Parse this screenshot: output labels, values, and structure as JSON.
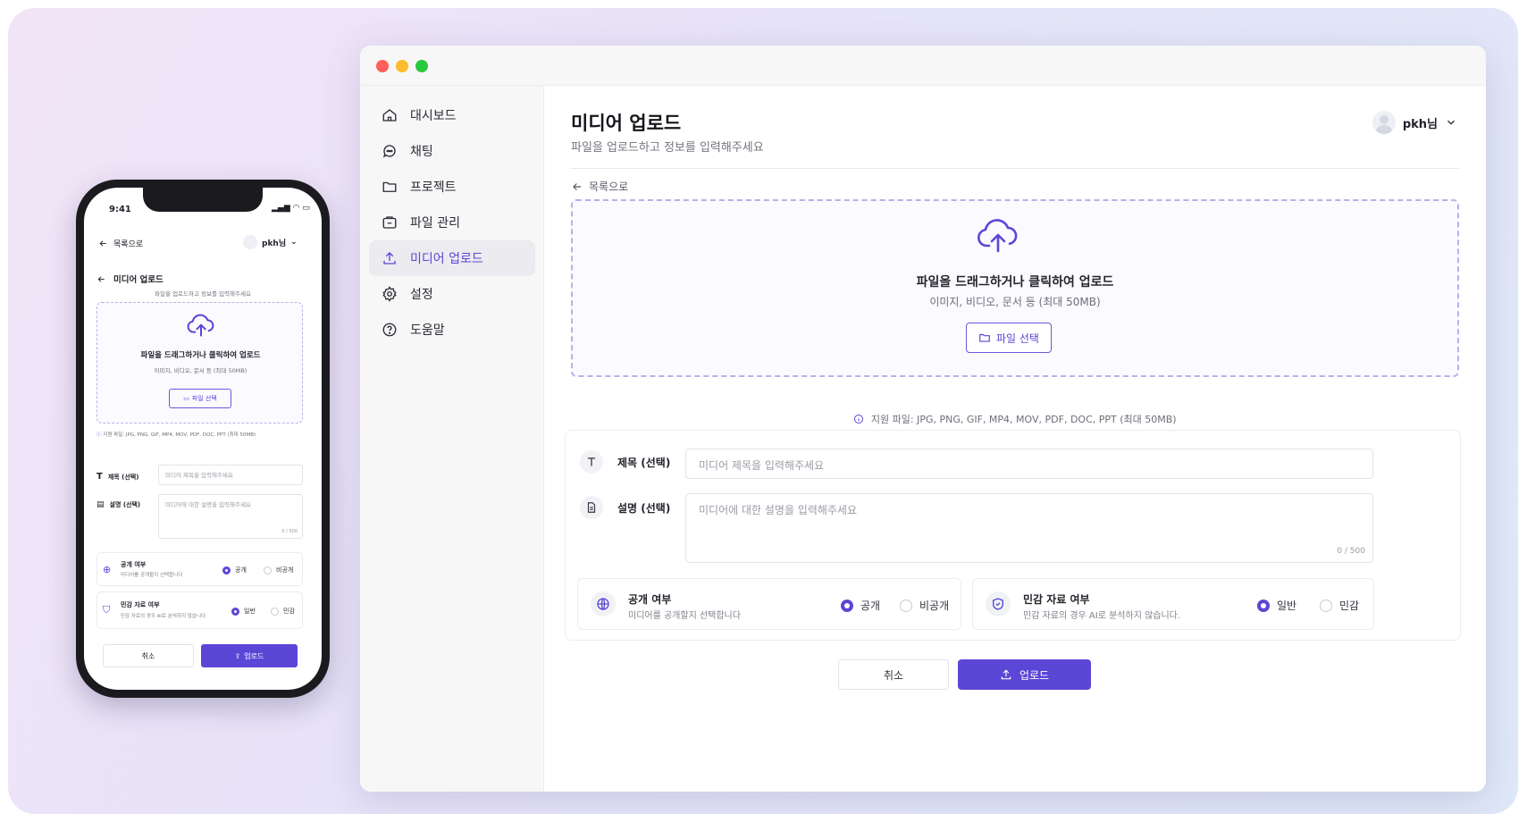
{
  "window": {
    "controls": [
      "close",
      "minimize",
      "maximize"
    ]
  },
  "sidebar": {
    "items": [
      {
        "label": "대시보드",
        "icon": "home-icon"
      },
      {
        "label": "채팅",
        "icon": "chat-icon"
      },
      {
        "label": "프로젝트",
        "icon": "folder-icon"
      },
      {
        "label": "파일 관리",
        "icon": "file-box-icon"
      },
      {
        "label": "미디어 업로드",
        "icon": "upload-icon",
        "active": true
      },
      {
        "label": "설정",
        "icon": "gear-icon"
      },
      {
        "label": "도움말",
        "icon": "help-icon"
      }
    ]
  },
  "header": {
    "title": "미디어 업로드",
    "subtitle": "파일을 업로드하고 정보를 입력해주세요",
    "user": "pkh님"
  },
  "back_label": "목록으로",
  "dropzone": {
    "title": "파일을 드래그하거나 클릭하여 업로드",
    "subtitle": "이미지, 비디오, 문서 등 (최대 50MB)",
    "button": "파일 선택"
  },
  "supported": "지원 파일: JPG, PNG, GIF, MP4, MOV, PDF, DOC, PPT (최대 50MB)",
  "form": {
    "title_label": "제목 (선택)",
    "title_placeholder": "미디어 제목을 입력해주세요",
    "desc_label": "설명 (선택)",
    "desc_placeholder": "미디어에 대한 설명을 입력해주세요",
    "counter": "0 / 500",
    "public": {
      "title": "공개 여부",
      "desc": "미디어를 공개할지 선택합니다",
      "options": [
        "공개",
        "비공개"
      ],
      "selected": "공개"
    },
    "sensitive": {
      "title": "민감 자료 여부",
      "desc": "민감 자료의 경우 AI로 분석하지 않습니다.",
      "options": [
        "일반",
        "민감"
      ],
      "selected": "일반"
    }
  },
  "actions": {
    "cancel": "취소",
    "upload": "업로드"
  },
  "mobile": {
    "time": "9:41",
    "back_label": "목록으로",
    "user": "pkh님",
    "title": "미디어 업로드"
  },
  "colors": {
    "accent": "#5b46d6"
  }
}
